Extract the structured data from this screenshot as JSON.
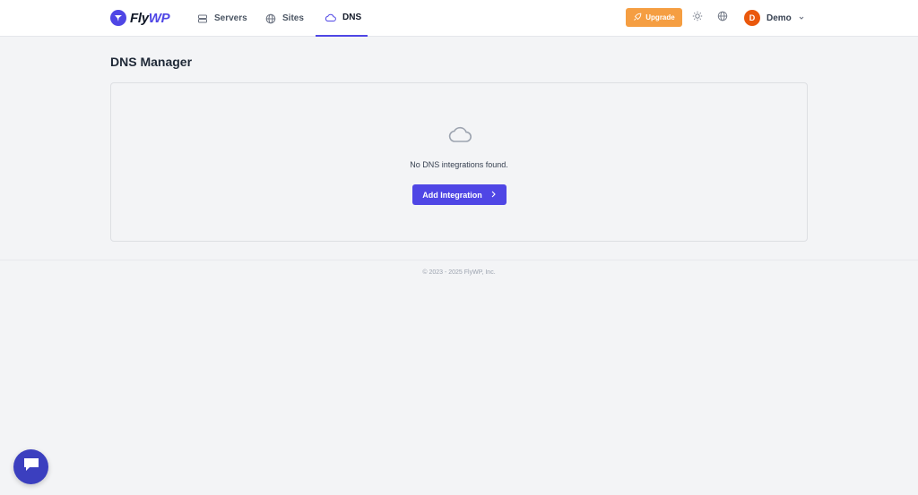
{
  "brand": {
    "name_part1": "Fly",
    "name_part2": "WP",
    "accent": "#4f46e5"
  },
  "nav": {
    "items": [
      {
        "label": "Servers",
        "icon": "server-icon",
        "active": false
      },
      {
        "label": "Sites",
        "icon": "globe-icon",
        "active": false
      },
      {
        "label": "DNS",
        "icon": "cloud-icon",
        "active": true
      }
    ]
  },
  "header": {
    "upgrade_label": "Upgrade",
    "upgrade_color": "#f59e42",
    "user": {
      "initial": "D",
      "name": "Demo",
      "avatar_color": "#ea580c"
    }
  },
  "main": {
    "title": "DNS Manager",
    "empty_message": "No DNS integrations found.",
    "add_button_label": "Add Integration"
  },
  "footer": {
    "copyright": "© 2023 - 2025 FlyWP, Inc."
  }
}
